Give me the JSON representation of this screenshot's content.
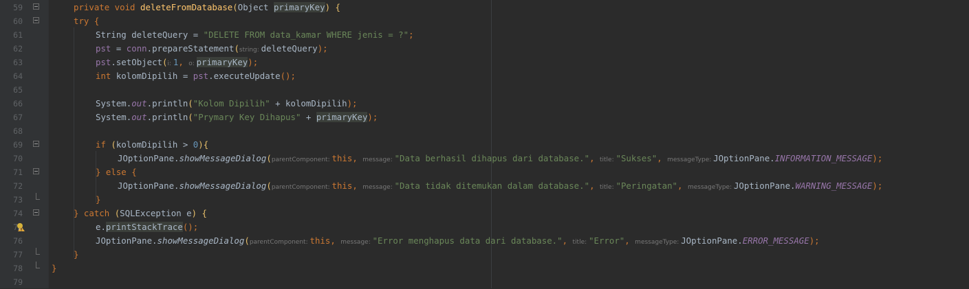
{
  "editor": {
    "line_numbers": [
      "59",
      "60",
      "61",
      "62",
      "63",
      "64",
      "65",
      "66",
      "67",
      "68",
      "69",
      "70",
      "71",
      "72",
      "73",
      "74",
      "75",
      "76",
      "77",
      "78",
      "79"
    ],
    "icons": {
      "intention_bulb": "warning-bulb-icon",
      "fold_open": "fold-minus-icon",
      "fold_end": "fold-end-icon"
    },
    "colors": {
      "background": "#2b2b2b",
      "gutter": "#313335",
      "keyword": "#cc7832",
      "function": "#ffc66d",
      "string": "#6a8759",
      "number": "#6897bb",
      "field": "#9876aa",
      "text": "#a9b7c6",
      "hint": "#787878"
    },
    "lines": [
      {
        "tokens": [
          {
            "t": "private void ",
            "c": "kw"
          },
          {
            "t": "deleteFromDatabase",
            "c": "fn"
          },
          {
            "t": "(",
            "c": "par"
          },
          {
            "t": "Object ",
            "c": ""
          },
          {
            "t": "primaryKey",
            "c": "hl2"
          },
          {
            "t": ") {",
            "c": "par"
          }
        ]
      },
      {
        "tokens": [
          {
            "t": "try {",
            "c": "kw"
          }
        ]
      },
      {
        "tokens": [
          {
            "t": "String ",
            "c": ""
          },
          {
            "t": "deleteQuery = ",
            "c": ""
          },
          {
            "t": "\"DELETE FROM data_kamar WHERE jenis = ?\"",
            "c": "str"
          },
          {
            "t": ";",
            "c": "kw"
          }
        ]
      },
      {
        "tokens": [
          {
            "t": "pst",
            "c": "fld"
          },
          {
            "t": " = ",
            "c": ""
          },
          {
            "t": "conn",
            "c": "fld"
          },
          {
            "t": ".prepareStatement",
            "c": ""
          },
          {
            "t": "(",
            "c": "par"
          },
          {
            "t": "string: ",
            "c": "hint"
          },
          {
            "t": "deleteQuery",
            "c": ""
          },
          {
            "t": ");",
            "c": "kw"
          }
        ]
      },
      {
        "tokens": [
          {
            "t": "pst",
            "c": "fld"
          },
          {
            "t": ".setObject",
            "c": ""
          },
          {
            "t": "(",
            "c": "par"
          },
          {
            "t": "i: ",
            "c": "hint"
          },
          {
            "t": "1",
            "c": "num"
          },
          {
            "t": ", ",
            "c": "kw"
          },
          {
            "t": "o: ",
            "c": "hint"
          },
          {
            "t": "primaryKey",
            "c": "hl2"
          },
          {
            "t": ");",
            "c": "kw"
          }
        ]
      },
      {
        "tokens": [
          {
            "t": "int ",
            "c": "kw"
          },
          {
            "t": "kolomDipilih = ",
            "c": ""
          },
          {
            "t": "pst",
            "c": "fld"
          },
          {
            "t": ".executeUpdate",
            "c": ""
          },
          {
            "t": "();",
            "c": "kw"
          }
        ]
      },
      {
        "tokens": []
      },
      {
        "tokens": [
          {
            "t": "System.",
            "c": ""
          },
          {
            "t": "out",
            "c": "fldi"
          },
          {
            "t": ".println",
            "c": ""
          },
          {
            "t": "(",
            "c": "par"
          },
          {
            "t": "\"Kolom Dipilih\"",
            "c": "str"
          },
          {
            "t": " + kolomDipilih",
            "c": ""
          },
          {
            "t": ");",
            "c": "kw"
          }
        ]
      },
      {
        "tokens": [
          {
            "t": "System.",
            "c": ""
          },
          {
            "t": "out",
            "c": "fldi"
          },
          {
            "t": ".println",
            "c": ""
          },
          {
            "t": "(",
            "c": "par"
          },
          {
            "t": "\"Prymary Key Dihapus\"",
            "c": "str"
          },
          {
            "t": " + ",
            "c": ""
          },
          {
            "t": "primaryKey",
            "c": "hl2"
          },
          {
            "t": ");",
            "c": "kw"
          }
        ]
      },
      {
        "tokens": []
      },
      {
        "tokens": [
          {
            "t": "if ",
            "c": "kw"
          },
          {
            "t": "(",
            "c": "par"
          },
          {
            "t": "kolomDipilih > ",
            "c": ""
          },
          {
            "t": "0",
            "c": "num"
          },
          {
            "t": "){",
            "c": "par"
          }
        ]
      },
      {
        "tokens": [
          {
            "t": "JOptionPane.",
            "c": ""
          },
          {
            "t": "showMessageDialog",
            "c": "mi"
          },
          {
            "t": "(",
            "c": "par"
          },
          {
            "t": "parentComponent: ",
            "c": "hint"
          },
          {
            "t": "this",
            "c": "kw"
          },
          {
            "t": ", ",
            "c": "kw"
          },
          {
            "t": "message: ",
            "c": "hint"
          },
          {
            "t": "\"Data berhasil dihapus dari database.\"",
            "c": "str"
          },
          {
            "t": ", ",
            "c": "kw"
          },
          {
            "t": "title: ",
            "c": "hint"
          },
          {
            "t": "\"Sukses\"",
            "c": "str"
          },
          {
            "t": ", ",
            "c": "kw"
          },
          {
            "t": "messageType: ",
            "c": "hint"
          },
          {
            "t": "JOptionPane.",
            "c": ""
          },
          {
            "t": "INFORMATION_MESSAGE",
            "c": "fldi"
          },
          {
            "t": ");",
            "c": "kw"
          }
        ]
      },
      {
        "tokens": [
          {
            "t": "} else {",
            "c": "kw"
          }
        ]
      },
      {
        "tokens": [
          {
            "t": "JOptionPane.",
            "c": ""
          },
          {
            "t": "showMessageDialog",
            "c": "mi"
          },
          {
            "t": "(",
            "c": "par"
          },
          {
            "t": "parentComponent: ",
            "c": "hint"
          },
          {
            "t": "this",
            "c": "kw"
          },
          {
            "t": ", ",
            "c": "kw"
          },
          {
            "t": "message: ",
            "c": "hint"
          },
          {
            "t": "\"Data tidak ditemukan dalam database.\"",
            "c": "str"
          },
          {
            "t": ", ",
            "c": "kw"
          },
          {
            "t": "title: ",
            "c": "hint"
          },
          {
            "t": "\"Peringatan\"",
            "c": "str"
          },
          {
            "t": ", ",
            "c": "kw"
          },
          {
            "t": "messageType: ",
            "c": "hint"
          },
          {
            "t": "JOptionPane.",
            "c": ""
          },
          {
            "t": "WARNING_MESSAGE",
            "c": "fldi"
          },
          {
            "t": ");",
            "c": "kw"
          }
        ]
      },
      {
        "tokens": [
          {
            "t": "}",
            "c": "kw"
          }
        ]
      },
      {
        "tokens": [
          {
            "t": "} catch ",
            "c": "kw"
          },
          {
            "t": "(",
            "c": "par"
          },
          {
            "t": "SQLException e",
            "c": ""
          },
          {
            "t": ") {",
            "c": "par"
          }
        ]
      },
      {
        "tokens": [
          {
            "t": "e.",
            "c": ""
          },
          {
            "t": "printStackTrace",
            "c": "hl2"
          },
          {
            "t": "();",
            "c": "kw"
          }
        ]
      },
      {
        "tokens": [
          {
            "t": "JOptionPane.",
            "c": ""
          },
          {
            "t": "showMessageDialog",
            "c": "mi"
          },
          {
            "t": "(",
            "c": "par"
          },
          {
            "t": "parentComponent: ",
            "c": "hint"
          },
          {
            "t": "this",
            "c": "kw"
          },
          {
            "t": ", ",
            "c": "kw"
          },
          {
            "t": "message: ",
            "c": "hint"
          },
          {
            "t": "\"Error menghapus data dari database.\"",
            "c": "str"
          },
          {
            "t": ", ",
            "c": "kw"
          },
          {
            "t": "title: ",
            "c": "hint"
          },
          {
            "t": "\"Error\"",
            "c": "str"
          },
          {
            "t": ", ",
            "c": "kw"
          },
          {
            "t": "messageType: ",
            "c": "hint"
          },
          {
            "t": "JOptionPane.",
            "c": ""
          },
          {
            "t": "ERROR_MESSAGE",
            "c": "fldi"
          },
          {
            "t": ");",
            "c": "kw"
          }
        ]
      },
      {
        "tokens": [
          {
            "t": "}",
            "c": "kw"
          }
        ]
      },
      {
        "tokens": [
          {
            "t": "}",
            "c": "kw"
          }
        ]
      },
      {
        "tokens": []
      }
    ]
  }
}
